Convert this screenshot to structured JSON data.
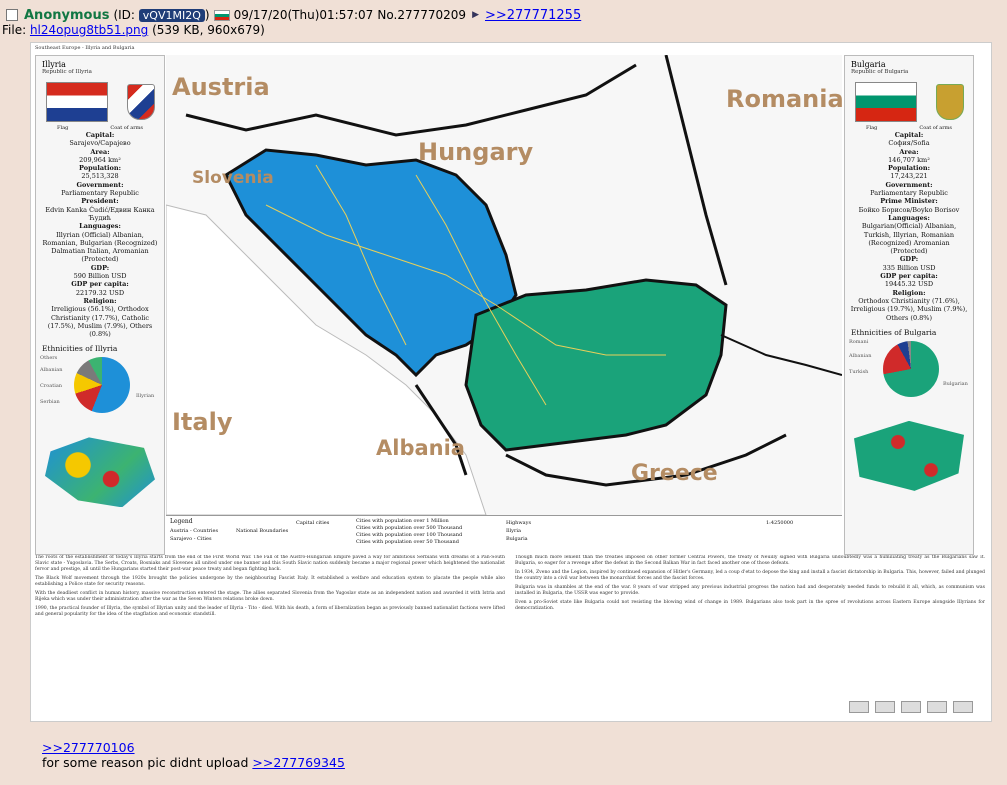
{
  "post": {
    "name": "Anonymous",
    "id_label": "(ID:",
    "id": "vQV1MI2Q",
    "id_close": ")",
    "datetime": "09/17/20(Thu)01:57:07",
    "number": "No.277770209",
    "arrow": "▶",
    "reply_link": ">>277771255"
  },
  "file": {
    "prefix": "File:",
    "filename": "hl24opug8tb51.png",
    "info": "(539 KB, 960x679)"
  },
  "map": {
    "title": "Southeast Europe - Illyria and Bulgaria",
    "labels": {
      "austria": "Austria",
      "hungary": "Hungary",
      "romania": "Romania",
      "slovenia": "Slovenia",
      "italy": "Italy",
      "albania": "Albania",
      "greece": "Greece"
    },
    "legend": {
      "title": "Legend",
      "items": [
        "Austria - Countries",
        "Sarajevo - Cities",
        "National Boundaries",
        "Capital cities",
        "Cities with population over 1 Million",
        "Cities with population over 500 Thousand",
        "Cities with population over 100 Thousand",
        "Cities with population over 50 Thousand",
        "Highways",
        "Illyria",
        "Bulgaria",
        "1:4250000"
      ]
    },
    "colors": {
      "illyria": "#1e90d8",
      "bulgaria": "#1aa37a",
      "border": "#111111"
    }
  },
  "illyria": {
    "name": "Illyria",
    "sub": "Republic of Illyria",
    "flag_caption": "Flag",
    "coa_caption": "Coat of arms",
    "facts": [
      {
        "label": "Capital:",
        "value": "Sarajevo/Сарајево"
      },
      {
        "label": "Area:",
        "value": "209,964 km²"
      },
      {
        "label": "Population:",
        "value": "25,513,328"
      },
      {
        "label": "Government:",
        "value": "Parliamentary Republic"
      },
      {
        "label": "President:",
        "value": "Edvin Kanka Ćudić/Едвин Канка Ћудић"
      },
      {
        "label": "Languages:",
        "value": "Illyrian (Official) Albanian, Romanian, Bulgarian (Recognized) Dalmatian Italian, Aromanian (Protected)"
      },
      {
        "label": "GDP:",
        "value": "590 Billion USD"
      },
      {
        "label": "GDP per capita:",
        "value": "22179.32 USD"
      },
      {
        "label": "Religion:",
        "value": "Irreligious (56.1%), Orthodox Christianity (17.7%), Catholic (17.5%), Muslim (7.9%), Others (0.8%)"
      }
    ],
    "eth_title": "Ethnicities of Illyria",
    "pie_labels": [
      "Others",
      "Albanian",
      "Croatian",
      "Serbian",
      "Illyrian"
    ]
  },
  "bulgaria": {
    "name": "Bulgaria",
    "sub": "Republic of Bulgaria",
    "flag_caption": "Flag",
    "coa_caption": "Coat of arms",
    "facts": [
      {
        "label": "Capital:",
        "value": "София/Sofia"
      },
      {
        "label": "Area:",
        "value": "146,707 km²"
      },
      {
        "label": "Population:",
        "value": "17,243,221"
      },
      {
        "label": "Government:",
        "value": "Parliamentary Republic"
      },
      {
        "label": "Prime Minister:",
        "value": "Бойко Борисов/Boyko Borisov"
      },
      {
        "label": "Languages:",
        "value": "Bulgarian(Official) Albanian, Turkish, Illyrian, Romanian (Recognized) Aromanian (Protected)"
      },
      {
        "label": "GDP:",
        "value": "335 Billion USD"
      },
      {
        "label": "GDP per capita:",
        "value": "19445.32 USD"
      },
      {
        "label": "Religion:",
        "value": "Orthodox Christianity (71.6%), Irreligious (19.7%), Muslim (7.9%), Others (0.8%)"
      }
    ],
    "eth_title": "Ethnicities of Bulgaria",
    "pie_labels": [
      "Romani",
      "Albanian",
      "Turkish",
      "Bulgarian"
    ]
  },
  "history": {
    "left": [
      "The roots of the establishment of today's Illyria starts from the end of the First World War. The Fall of the Austro-Hungarian Empire paved a way for ambitious Serbians with dreams of a Pan-South Slavic state - Yugoslavia. The Serbs, Croats, Bosniaks and Slovenes all united under one banner and this South Slavic nation suddenly became a major regional power which heightened the nationalist fervor and prestige, all until the Hungarians started their post-war peace treaty and began fighting back.",
      "The Black Wolf movement through the 1920s brought the policies undergone by the neighbouring Fascist Italy. It established a welfare and education system to placate the people while also establishing a Police state for security reasons.",
      "With the deadliest conflict in human history, massive reconstruction entered the stage. The allies separated Slovenia from the Yugoslav state as an independent nation and awarded it with Istria and Rijeka which was under their administration after the war as the Seven Winters relations broke down.",
      "1990, the practical founder of Illyria, the symbol of Illyrian unity and the leader of Illyria - Tito - died. With his death, a form of liberalization began as previously banned nationalist factions were lifted and general popularity for the idea of the stagflation and economic standstill."
    ],
    "right": [
      "Though much more lenient than the treaties imposed on other former Central Powers, the treaty of Neuilly signed with Bulgaria undoubtedly was a humiliating treaty as the Bulgarians saw it. Bulgaria, so eager for a revenge after the defeat in the Second Balkan War in fact faced another one of those defeats.",
      "In 1934, Zveno and the Legion, inspired by continued expansion of Hitler's Germany, led a coup d'etat to depose the king and install a fascist dictatorship in Bulgaria. This, however, failed and plunged the country into a civil war between the monarchist forces and the fascist forces.",
      "Bulgaria was in shambles at the end of the war. 8 years of war stripped any previous industrial progress the nation had and desperately needed funds to rebuild it all, which, as communism was installed in Bulgaria, the USSR was eager to provide.",
      "Even a pro-Soviet state like Bulgaria could not resisting the blowing wind of change in 1989. Bulgarians also took part in the spree of revolutions across Eastern Europe alongside Illyrians for democratization."
    ]
  },
  "footer": {
    "link1": ">>277770106",
    "text": "for some reason pic didnt upload",
    "link2": ">>277769345"
  }
}
